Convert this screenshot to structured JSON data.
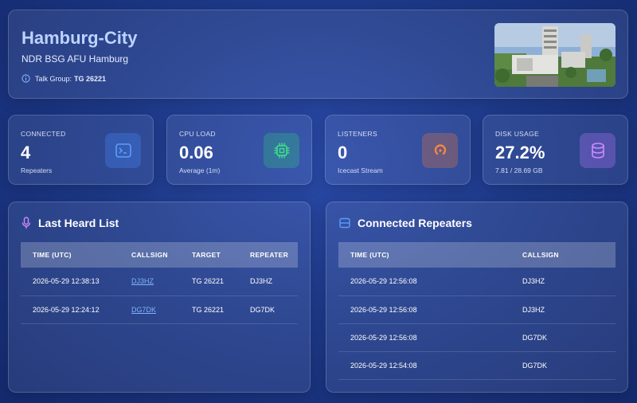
{
  "header": {
    "title": "Hamburg-City",
    "subtitle": "NDR BSG AFU Hamburg",
    "talk_group_label": "Talk Group:",
    "talk_group_value": "TG 26221"
  },
  "stats": [
    {
      "label": "CONNECTED",
      "value": "4",
      "sub": "Repeaters",
      "icon": "terminal-icon",
      "color": "#4a8cff"
    },
    {
      "label": "CPU LOAD",
      "value": "0.06",
      "sub": "Average (1m)",
      "icon": "cpu-chip-icon",
      "color": "#2fd37a"
    },
    {
      "label": "LISTENERS",
      "value": "0",
      "sub": "Icecast Stream",
      "icon": "stream-icon",
      "color": "#ff7a33"
    },
    {
      "label": "DISK USAGE",
      "value": "27.2%",
      "sub": "7.81 / 28.69 GB",
      "icon": "database-icon",
      "color": "#c07cff"
    }
  ],
  "last_heard": {
    "title": "Last Heard List",
    "columns": [
      "TIME (UTC)",
      "CALLSIGN",
      "TARGET",
      "REPEATER"
    ],
    "rows": [
      {
        "time": "2026-05-29 12:38:13",
        "callsign": "DJ3HZ",
        "target": "TG 26221",
        "repeater": "DJ3HZ"
      },
      {
        "time": "2026-05-29 12:24:12",
        "callsign": "DG7DK",
        "target": "TG 26221",
        "repeater": "DG7DK"
      }
    ]
  },
  "connected_repeaters": {
    "title": "Connected Repeaters",
    "columns": [
      "TIME (UTC)",
      "CALLSIGN"
    ],
    "rows": [
      {
        "time": "2026-05-29 12:56:08",
        "callsign": "DJ3HZ"
      },
      {
        "time": "2026-05-29 12:56:08",
        "callsign": "DJ3HZ"
      },
      {
        "time": "2026-05-29 12:56:08",
        "callsign": "DG7DK"
      },
      {
        "time": "2026-05-29 12:54:08",
        "callsign": "DG7DK"
      }
    ]
  }
}
